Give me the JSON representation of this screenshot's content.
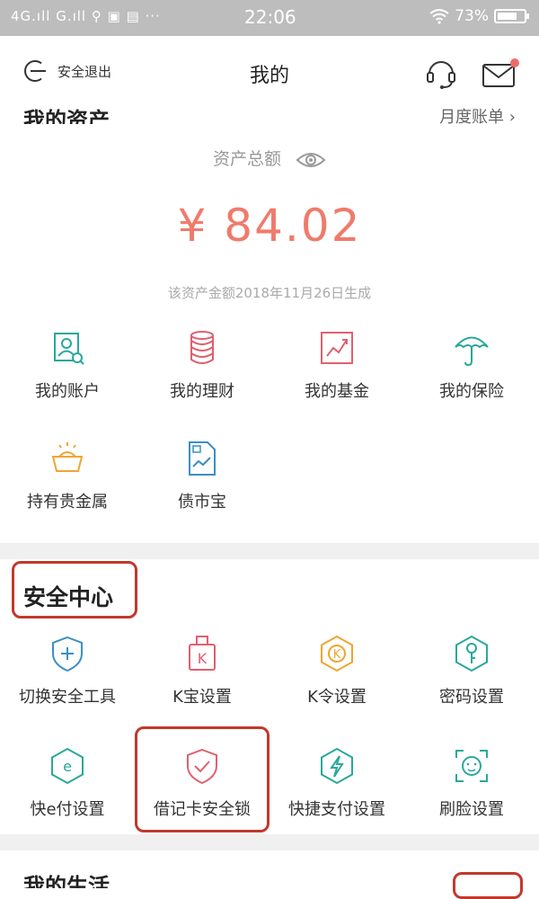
{
  "status_bar": {
    "left": "4G.ıll  G.ıll  ⚲ ▣ ▤ ···",
    "time": "22:06",
    "battery": "73%"
  },
  "header": {
    "logout_label": "安全退出",
    "title": "我的"
  },
  "assets": {
    "title": "我的资产",
    "monthly_bill": "月度账单",
    "total_label": "资产总额",
    "amount": "¥ 84.02",
    "generated": "该资产金额2018年11月26日生成",
    "items": [
      {
        "label": "我的账户",
        "icon": "account-icon"
      },
      {
        "label": "我的理财",
        "icon": "coins-icon"
      },
      {
        "label": "我的基金",
        "icon": "fund-chart-icon"
      },
      {
        "label": "我的保险",
        "icon": "umbrella-icon"
      },
      {
        "label": "持有贵金属",
        "icon": "gold-basket-icon"
      },
      {
        "label": "债市宝",
        "icon": "bond-doc-icon"
      }
    ]
  },
  "security": {
    "title": "安全中心",
    "items": [
      {
        "label": "切换安全工具",
        "icon": "shield-switch-icon"
      },
      {
        "label": "K宝设置",
        "icon": "k-bao-icon"
      },
      {
        "label": "K令设置",
        "icon": "k-ling-icon"
      },
      {
        "label": "密码设置",
        "icon": "key-icon"
      },
      {
        "label": "快e付设置",
        "icon": "e-pay-icon"
      },
      {
        "label": "借记卡安全锁",
        "icon": "shield-check-icon"
      },
      {
        "label": "快捷支付设置",
        "icon": "lightning-icon"
      },
      {
        "label": "刷脸设置",
        "icon": "face-scan-icon"
      }
    ]
  },
  "life": {
    "title": "我的生活"
  },
  "colors": {
    "accent_green": "#2aa89a",
    "accent_red": "#e0606e",
    "accent_orange": "#f0a531",
    "highlight": "#c0392b"
  }
}
